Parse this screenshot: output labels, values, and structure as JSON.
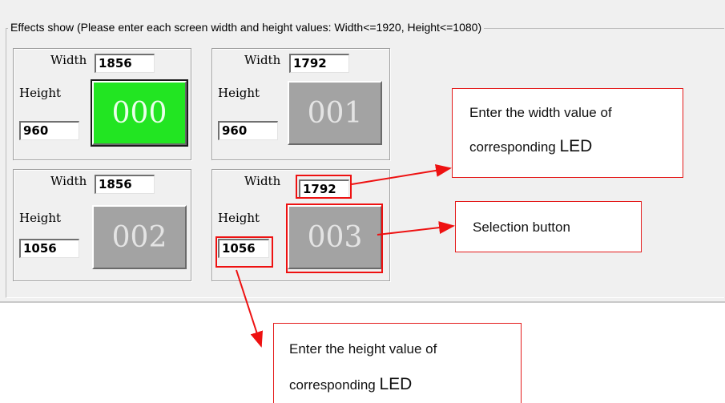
{
  "group": {
    "title": "Effects show (Please enter each screen width and height values: Width<=1920, Height<=1080)"
  },
  "screens": [
    {
      "width_label": "Width",
      "width_value": "1856",
      "height_label": "Height",
      "height_value": "960",
      "button_label": "000",
      "selected": true
    },
    {
      "width_label": "Width",
      "width_value": "1792",
      "height_label": "Height",
      "height_value": "960",
      "button_label": "001",
      "selected": false
    },
    {
      "width_label": "Width",
      "width_value": "1856",
      "height_label": "Height",
      "height_value": "1056",
      "button_label": "002",
      "selected": false
    },
    {
      "width_label": "Width",
      "width_value": "1792",
      "height_label": "Height",
      "height_value": "1056",
      "button_label": "003",
      "selected": false
    }
  ],
  "annotations": {
    "width_callout": {
      "line1": "Enter the width value of",
      "line2": "corresponding ",
      "line2_big": "LED"
    },
    "selection_callout": {
      "text": "Selection button"
    },
    "height_callout": {
      "line1": "Enter the height value of",
      "line2": "corresponding ",
      "line2_big": "LED"
    }
  },
  "colors": {
    "selected_button": "#22e522",
    "button": "#a3a3a3",
    "annotation": "#ee1111"
  }
}
